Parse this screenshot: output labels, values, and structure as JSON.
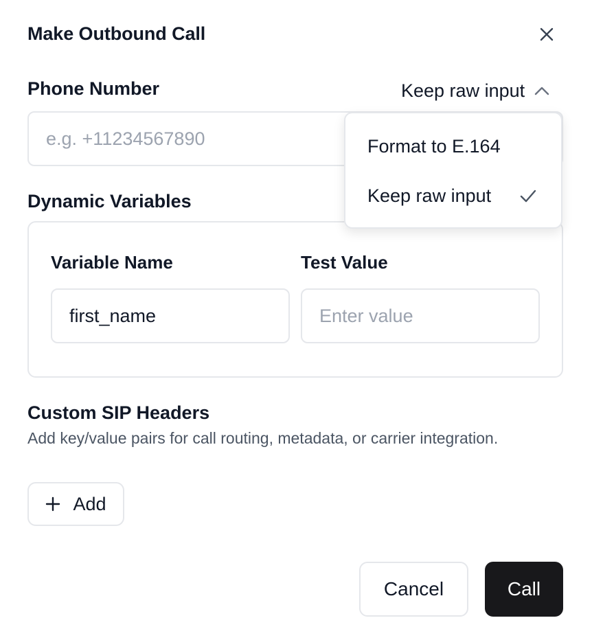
{
  "dialog": {
    "title": "Make Outbound Call",
    "close_icon": "close-icon"
  },
  "phone": {
    "label": "Phone Number",
    "placeholder": "e.g. +11234567890",
    "format_selected": "Keep raw input",
    "format_icon": "chevron-up-icon"
  },
  "format_menu": {
    "options": [
      {
        "label": "Format to E.164",
        "selected": false
      },
      {
        "label": "Keep raw input",
        "selected": true
      }
    ],
    "selected_icon": "check-icon"
  },
  "variables": {
    "label": "Dynamic Variables",
    "name_header": "Variable Name",
    "value_header": "Test Value",
    "rows": [
      {
        "name": "first_name",
        "value": "",
        "value_placeholder": "Enter value"
      }
    ]
  },
  "sip": {
    "label": "Custom SIP Headers",
    "description": "Add key/value pairs for call routing, metadata, or carrier integration.",
    "add_label": "Add",
    "add_icon": "plus-icon"
  },
  "footer": {
    "cancel_label": "Cancel",
    "call_label": "Call"
  },
  "colors": {
    "primary_button_bg": "#18181b",
    "border": "#e5e7eb",
    "muted_text": "#4b5563",
    "placeholder": "#9ca3af"
  }
}
